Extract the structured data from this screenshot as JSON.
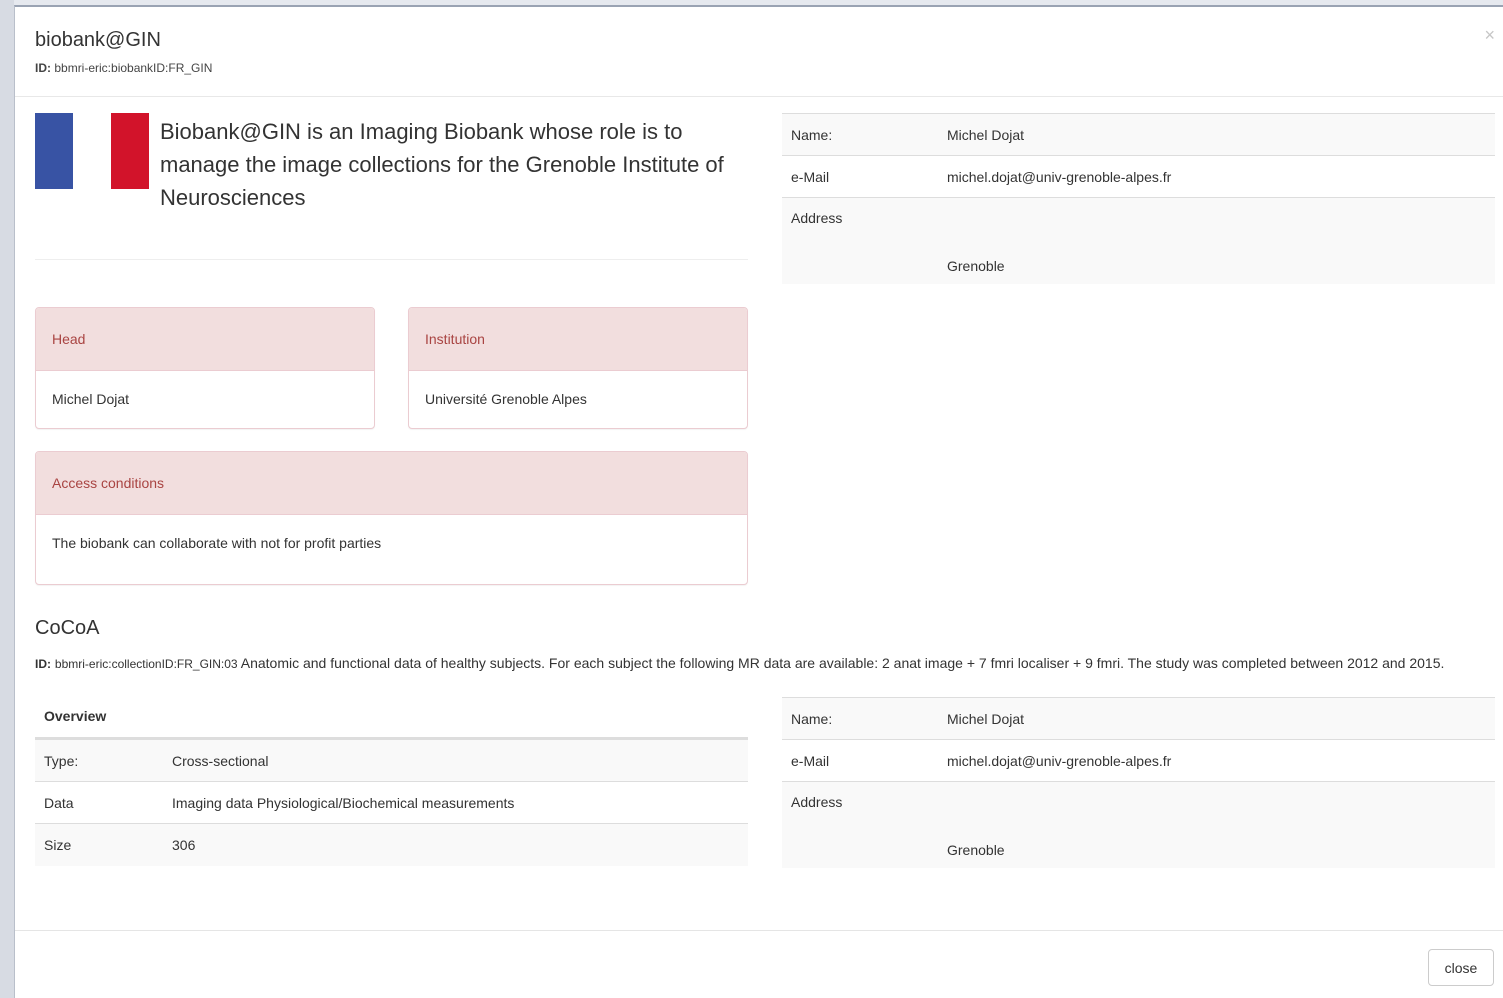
{
  "modal": {
    "title": "biobank@GIN",
    "id_label": "ID:",
    "id_value": "bbmri-eric:biobankID:FR_GIN",
    "close_x": "×",
    "close_button": "close"
  },
  "flag": {
    "colors": [
      "#3853a4",
      "#ffffff",
      "#d2132a"
    ],
    "icon": "france-flag-icon"
  },
  "biobank": {
    "description": "Biobank@GIN is an Imaging Biobank whose role is to manage the image collections for the Grenoble Institute of Neurosciences",
    "contact": {
      "name_label": "Name:",
      "name": "Michel Dojat",
      "email_label": "e-Mail",
      "email": "michel.dojat@univ-grenoble-alpes.fr",
      "address_label": "Address",
      "address": "Grenoble"
    },
    "head": {
      "title": "Head",
      "value": "Michel Dojat"
    },
    "institution": {
      "title": "Institution",
      "value": "Université Grenoble Alpes"
    },
    "access": {
      "title": "Access conditions",
      "value": "The biobank can collaborate with not for profit parties"
    }
  },
  "collection": {
    "name": "CoCoA",
    "id_label": "ID:",
    "id_value": "bbmri-eric:collectionID:FR_GIN:03",
    "description": "Anatomic and functional data of healthy subjects. For each subject the following MR data are available: 2 anat image + 7 fmri localiser + 9 fmri. The study was completed between 2012 and 2015.",
    "overview_title": "Overview",
    "overview": [
      {
        "label": "Type:",
        "value": "Cross-sectional"
      },
      {
        "label": "Data",
        "value": "Imaging data Physiological/Biochemical measurements"
      },
      {
        "label": "Size",
        "value": "306"
      }
    ],
    "contact": {
      "name_label": "Name:",
      "name": "Michel Dojat",
      "email_label": "e-Mail",
      "email": "michel.dojat@univ-grenoble-alpes.fr",
      "address_label": "Address",
      "address": "Grenoble"
    }
  },
  "colors": {
    "panel_heading_bg": "#f2dede",
    "panel_heading_text": "#a94442",
    "striped_row": "#f9f9f9"
  }
}
